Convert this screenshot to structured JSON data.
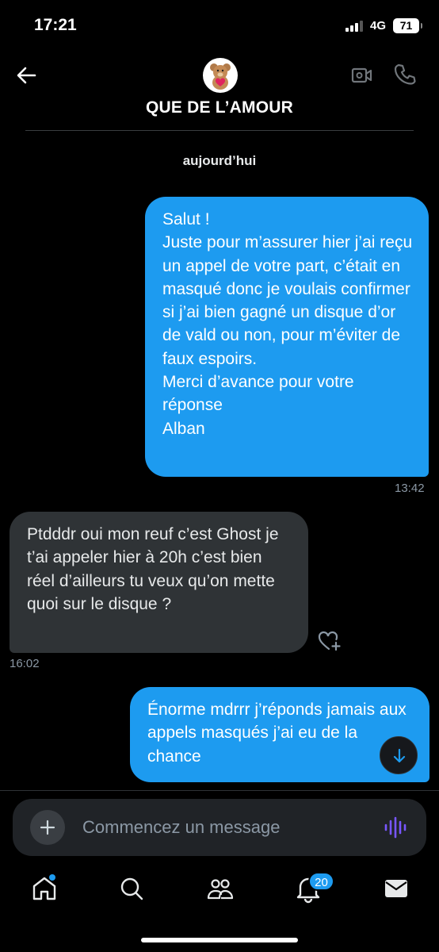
{
  "status": {
    "time": "17:21",
    "network": "4G",
    "battery": "71"
  },
  "header": {
    "contact_name": "QUE DE L’AMOUR"
  },
  "conversation": {
    "date": "aujourd’hui",
    "messages": [
      {
        "direction": "sent",
        "text": "Salut !\nJuste pour m’assurer hier j’ai reçu un appel de votre part, c’était en masqué donc je voulais confirmer si j’ai bien gagné un disque d’or de vald ou non, pour m’éviter de faux espoirs.\nMerci d’avance pour votre réponse\nAlban",
        "time": "13:42"
      },
      {
        "direction": "received",
        "text": "Ptdddr oui mon reuf c’est Ghost je t’ai appeler hier à 20h c’est bien réel d’ailleurs tu veux qu’on mette quoi sur le disque ?",
        "time": "16:02"
      },
      {
        "direction": "sent",
        "text": "Énorme mdrrr j’réponds jamais aux appels masqués j’ai eu de la chance",
        "time": ""
      }
    ]
  },
  "composer": {
    "placeholder": "Commencez un message"
  },
  "tabbar": {
    "notifications_count": "20"
  },
  "colors": {
    "accent": "#1d9bf0",
    "received_bubble": "#2f3336",
    "background": "#000000",
    "voice": "#7856ff"
  }
}
